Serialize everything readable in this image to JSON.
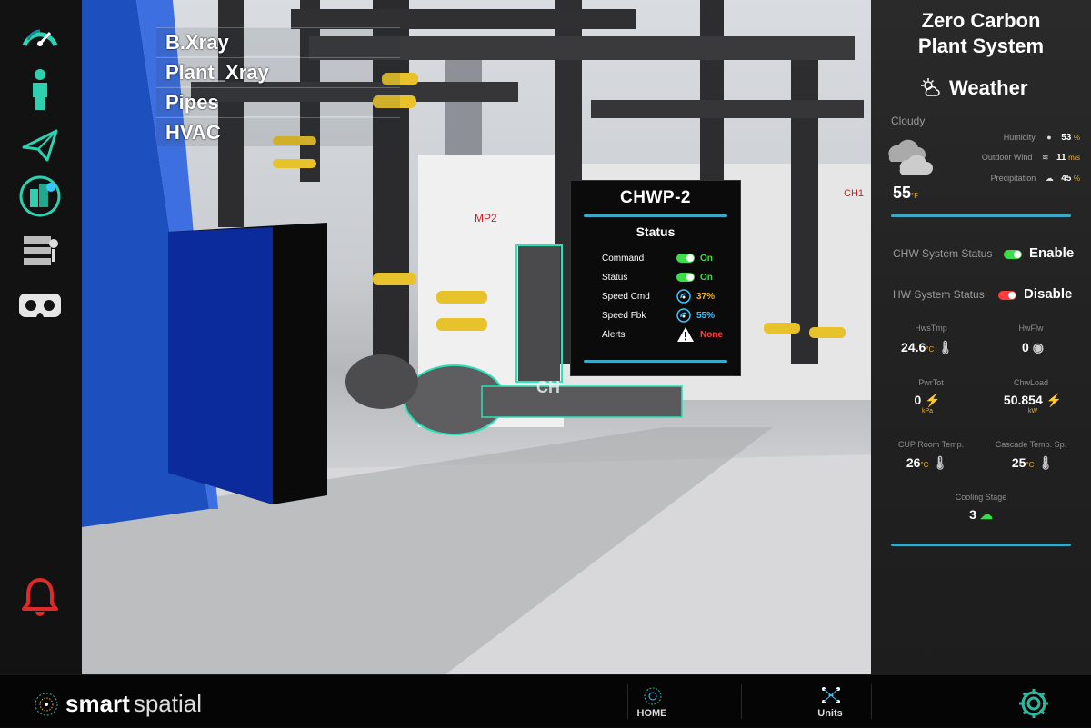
{
  "layers": [
    "B.Xray",
    "Plant_Xray",
    "Pipes",
    "HVAC"
  ],
  "popup": {
    "title": "CHWP-2",
    "subtitle": "Status",
    "rows": [
      {
        "label": "Command",
        "value": "On",
        "color": "#3ddc4a"
      },
      {
        "label": "Status",
        "value": "On",
        "color": "#3ddc4a"
      },
      {
        "label": "Speed Cmd",
        "value": "37%",
        "color": "#f0b020"
      },
      {
        "label": "Speed Fbk",
        "value": "55%",
        "color": "#3ac6ff"
      },
      {
        "label": "Alerts",
        "value": "None",
        "color": "#ff4040"
      }
    ]
  },
  "scene_labels": {
    "pump_left": "MP2",
    "chiller": "CH1",
    "pump_tag": "CH"
  },
  "panel": {
    "title_line1": "Zero Carbon",
    "title_line2": "Plant System",
    "weather_label": "Weather",
    "condition": "Cloudy",
    "temp": "55",
    "temp_unit": "°F",
    "humidity_label": "Humidity",
    "humidity_value": "53",
    "humidity_unit": "%",
    "wind_label": "Outdoor Wind",
    "wind_value": "11",
    "wind_unit": "m/s",
    "precip_label": "Precipitation",
    "precip_value": "45",
    "precip_unit": "%",
    "chw_label": "CHW System Status",
    "chw_value": "Enable",
    "hw_label": "HW System Status",
    "hw_value": "Disable",
    "hws_label": "HwsTmp",
    "hws_value": "24.6",
    "hws_unit": "°C",
    "hwflw_label": "HwFlw",
    "hwflw_value": "0",
    "pwr_label": "PwrTot",
    "pwr_value": "0",
    "pwr_unit": "kPa",
    "chwload_label": "ChwLoad",
    "chwload_value": "50.854",
    "chwload_unit": "kW",
    "cup_label": "CUP Room Temp.",
    "cup_value": "26",
    "cup_unit": "°C",
    "cascade_label": "Cascade Temp. Sp.",
    "cascade_value": "25",
    "cascade_unit": "°C",
    "cooling_label": "Cooling Stage",
    "cooling_value": "3"
  },
  "bottom": {
    "brand_smart": "smart",
    "brand_spatial": "spatial",
    "home": "HOME",
    "units": "Units"
  },
  "colors": {
    "accent": "#3aa9c6",
    "enable": "#3ddc4a",
    "disable": "#ff3b3b",
    "warn": "#f0b020",
    "alarm": "#e02a2a",
    "brand": "#2fb8a0"
  }
}
